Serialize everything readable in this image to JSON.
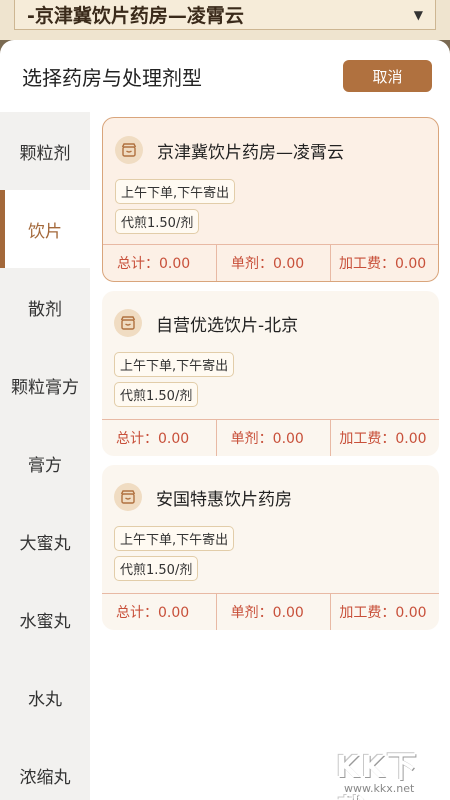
{
  "background": {
    "selected_pharmacy": "-京津冀饮片药房—凌霄云"
  },
  "sheet": {
    "title": "选择药房与处理剂型",
    "cancel_label": "取消"
  },
  "side_nav": {
    "items": [
      {
        "label": "颗粒剂",
        "active": false
      },
      {
        "label": "饮片",
        "active": true
      },
      {
        "label": "散剂",
        "active": false
      },
      {
        "label": "颗粒膏方",
        "active": false
      },
      {
        "label": "膏方",
        "active": false
      },
      {
        "label": "大蜜丸",
        "active": false
      },
      {
        "label": "水蜜丸",
        "active": false
      },
      {
        "label": "水丸",
        "active": false
      },
      {
        "label": "浓缩丸",
        "active": false
      }
    ]
  },
  "pharmacies": [
    {
      "name": "京津冀饮片药房—凌霄云",
      "selected": true,
      "tag_shipping": "上午下单,下午寄出",
      "tag_decoct": "代煎1.50/剂",
      "total": "总计：0.00",
      "per_dose": "单剂：0.00",
      "processing_fee": "加工费：0.00"
    },
    {
      "name": "自营优选饮片-北京",
      "selected": false,
      "tag_shipping": "上午下单,下午寄出",
      "tag_decoct": "代煎1.50/剂",
      "total": "总计：0.00",
      "per_dose": "单剂：0.00",
      "processing_fee": "加工费：0.00"
    },
    {
      "name": "安国特惠饮片药房",
      "selected": false,
      "tag_shipping": "上午下单,下午寄出",
      "tag_decoct": "代煎1.50/剂",
      "total": "总计：0.00",
      "per_dose": "单剂：0.00",
      "processing_fee": "加工费：0.00"
    }
  ],
  "watermark": {
    "text": "KK下载",
    "url": "www.kkx.net"
  },
  "colors": {
    "accent": "#a3683a",
    "button": "#b0713f",
    "price_red": "#c8503a"
  }
}
